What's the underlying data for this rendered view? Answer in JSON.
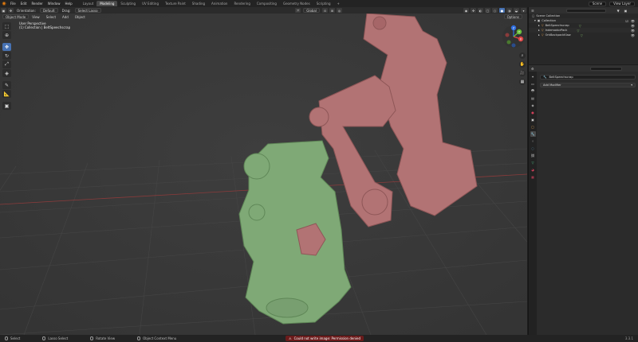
{
  "topbar": {
    "menus": [
      "File",
      "Edit",
      "Render",
      "Window",
      "Help"
    ],
    "workspaces": [
      "Layout",
      "Modeling",
      "Sculpting",
      "UV Editing",
      "Texture Paint",
      "Shading",
      "Animation",
      "Rendering",
      "Compositing",
      "Geometry Nodes",
      "Scripting"
    ],
    "active_workspace": "Modeling",
    "scene": "Scene",
    "view_layer": "View Layer"
  },
  "viewport_header": {
    "orientation_label": "Orientation:",
    "orientation_value": "Default",
    "drag_label": "Drag:",
    "drag_value": "Select Lasso",
    "transform_value": "Global"
  },
  "viewport_sub": {
    "mode": "Object Mode",
    "menus": [
      "View",
      "Select",
      "Add",
      "Object"
    ],
    "options": "Options"
  },
  "viewport_info": {
    "line1": "User Perspective",
    "line2": "(1) Collection | BeltSpeechscrap"
  },
  "gizmo": {
    "x": "X",
    "y": "Y",
    "z": "Z"
  },
  "outliner": {
    "root": "Scene Collection",
    "collection": "Collection",
    "items": [
      {
        "name": "BeltSpeechscrap"
      },
      {
        "name": "IndemadorPack"
      },
      {
        "name": "OrkBackpackKlaw"
      }
    ]
  },
  "properties": {
    "object_name": "BeltSpeechscrap",
    "add_modifier": "Add Modifier"
  },
  "statusbar": {
    "hints": [
      "Select",
      "Lasso Select",
      "Rotate View",
      "Object Context Menu"
    ],
    "error": "Could not write image: Permission denied",
    "version": "3.3.1"
  },
  "colors": {
    "accent": "#4772b3",
    "viewport_bg": "#3a3a3a",
    "green_model": "#7fa976",
    "red_model": "#b27374",
    "error_bg": "#6b1b1b"
  }
}
